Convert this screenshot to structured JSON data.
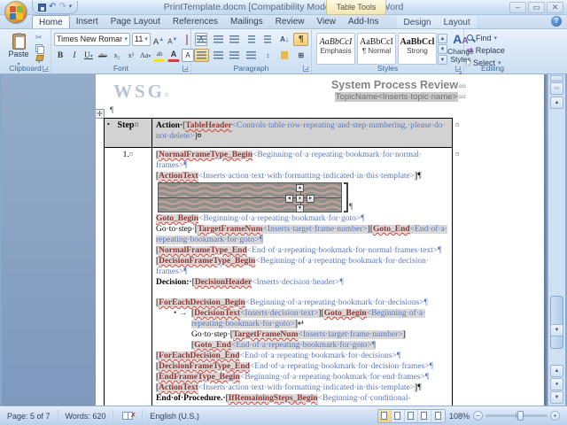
{
  "window": {
    "title": "PrintTemplate.docm [Compatibility Mode] - Microsoft Word",
    "context_group": "Table Tools",
    "minimize": "–",
    "restore": "▭",
    "close": "✕"
  },
  "tabs": {
    "main": [
      "Home",
      "Insert",
      "Page Layout",
      "References",
      "Mailings",
      "Review",
      "View",
      "Add-Ins"
    ],
    "active": "Home",
    "contextual": [
      "Design",
      "Layout"
    ]
  },
  "ribbon": {
    "clipboard": {
      "label": "Clipboard",
      "paste": "Paste"
    },
    "font": {
      "label": "Font",
      "family": "Times New Roman",
      "size": "11"
    },
    "paragraph": {
      "label": "Paragraph"
    },
    "styles": {
      "label": "Styles",
      "gallery": [
        {
          "sample": "AaBbCcI",
          "name": "Emphasis"
        },
        {
          "sample": "AaBbCcI",
          "name": "¶ Normal"
        },
        {
          "sample": "AaBbCcl",
          "name": "Strong"
        }
      ],
      "change_styles": "Change Styles"
    },
    "editing": {
      "label": "Editing",
      "find": "Find",
      "replace": "Replace",
      "select": "Select"
    }
  },
  "document": {
    "logo": "WSG",
    "logo_mark": "¤",
    "heading": "System Process Review",
    "heading_marks": "¤¤",
    "subheading": "TopicName<Inserts topic name>",
    "subheading_marks": "¤¤",
    "pilcrow": "¶",
    "table": {
      "row_end_mark": "¤",
      "header": {
        "bullet": "•",
        "step": "Step",
        "step_mark": "¤",
        "action_segments": [
          {
            "s": "bd",
            "t": "Action "
          },
          {
            "s": "gbh",
            "t": "["
          },
          {
            "s": "bk",
            "t": "TableHeader"
          },
          {
            "s": "blh",
            "t": "<Controls table row repeating and step numbering, please do not delete>"
          },
          {
            "s": "gbh",
            "t": "]"
          },
          {
            "s": "bd",
            "t": "¤"
          }
        ]
      },
      "row": {
        "step": "1.",
        "step_mark": "¤",
        "paragraphs": [
          {
            "segments": [
              {
                "s": "gb",
                "t": "["
              },
              {
                "s": "bk",
                "t": "NormalFrameType_Begin"
              },
              {
                "s": "blp",
                "t": "<Beginning of a repeating bookmark for normal frames>¶"
              }
            ]
          },
          {
            "segments": [
              {
                "s": "gb",
                "t": "["
              },
              {
                "s": "bk",
                "t": "ActionText"
              },
              {
                "s": "blp",
                "t": "<Inserts action text with formatting indicated in this template>"
              },
              {
                "s": "gb",
                "t": "]"
              },
              {
                "s": "nm",
                "t": "¶"
              }
            ]
          },
          {
            "type": "image",
            "alt": "selected placeholder frame with wavy texture and navigation arrows"
          },
          {
            "segments": [
              {
                "s": "bk",
                "t": "Goto_Begin"
              },
              {
                "s": "blp",
                "t": "<Beginning of a repeating bookmark for goto>¶"
              }
            ]
          },
          {
            "segments": [
              {
                "s": "nm",
                "t": "Go to step "
              },
              {
                "s": "gb",
                "t": "["
              },
              {
                "s": "bk",
                "t": "TargetFrameNum"
              },
              {
                "s": "bl",
                "t": "<Inserts target frame number>"
              },
              {
                "s": "gb",
                "t": "]["
              },
              {
                "s": "bk",
                "t": "Goto_End"
              },
              {
                "s": "bl",
                "t": "<End of a repeating bookmark for goto>¶"
              }
            ]
          },
          {
            "segments": [
              {
                "s": "gb",
                "t": "["
              },
              {
                "s": "bk",
                "t": "NormalFrameType_End"
              },
              {
                "s": "blp",
                "t": "<End of a repeating bookmark for normal frames text>¶"
              }
            ]
          },
          {
            "segments": [
              {
                "s": "gb",
                "t": "["
              },
              {
                "s": "bk",
                "t": "DecisionFrameType_Begin"
              },
              {
                "s": "blp",
                "t": "<Beginning of a repeating bookmark for decision frames>¶"
              }
            ]
          },
          {
            "segments": [
              {
                "s": "bd",
                "t": "Decision: "
              },
              {
                "s": "gb",
                "t": "["
              },
              {
                "s": "bk",
                "t": "DecisionHeader"
              },
              {
                "s": "blp",
                "t": "<Inserts decision header>¶"
              }
            ]
          },
          {
            "type": "gap"
          },
          {
            "segments": [
              {
                "s": "gb",
                "t": "["
              },
              {
                "s": "bk",
                "t": "ForEachDecision_Begin"
              },
              {
                "s": "blp",
                "t": "<Beginning of a repeating bookmark for decisions>¶"
              }
            ]
          },
          {
            "indent": true,
            "bullet": "• →",
            "segments": [
              {
                "s": "gb",
                "t": "["
              },
              {
                "s": "bk",
                "t": "DecisionText"
              },
              {
                "s": "bl",
                "t": "<Inserts decision text>"
              },
              {
                "s": "gb",
                "t": "]["
              },
              {
                "s": "bk",
                "t": "Goto_Begin"
              },
              {
                "s": "bl",
                "t": "<Beginning of a repeating bookmark for goto>"
              },
              {
                "s": "gb",
                "t": "]"
              },
              {
                "s": "nm",
                "t": "↵"
              }
            ]
          },
          {
            "indent": true,
            "segments": [
              {
                "s": "nm",
                "t": "Go to step "
              },
              {
                "s": "gb",
                "t": "["
              },
              {
                "s": "bk",
                "t": "TargetFrameNum"
              },
              {
                "s": "bl",
                "t": "<Inserts target frame number>"
              },
              {
                "s": "gb",
                "t": "]["
              },
              {
                "s": "bk",
                "t": "Goto_End"
              },
              {
                "s": "bl",
                "t": "<End of a repeating bookmark for goto>¶"
              }
            ]
          },
          {
            "segments": [
              {
                "s": "gb",
                "t": "["
              },
              {
                "s": "bk",
                "t": "ForEachDecision_End"
              },
              {
                "s": "blp",
                "t": "<End of a repeating bookmark for decisions>¶"
              }
            ]
          },
          {
            "segments": [
              {
                "s": "gb",
                "t": "["
              },
              {
                "s": "bk",
                "t": "DecisionFrameType_End"
              },
              {
                "s": "blp",
                "t": "<End of a repeating bookmark for decision frames>¶"
              }
            ]
          },
          {
            "segments": [
              {
                "s": "gb",
                "t": "["
              },
              {
                "s": "bk",
                "t": "EndFrameType_Begin"
              },
              {
                "s": "blp",
                "t": "<Beginning of a repeating bookmark for end frames>¶"
              }
            ]
          },
          {
            "segments": [
              {
                "s": "gb",
                "t": "["
              },
              {
                "s": "bk",
                "t": "ActionText"
              },
              {
                "s": "blp",
                "t": "<Inserts action text with formatting indicated in this template>"
              },
              {
                "s": "gb",
                "t": "]"
              },
              {
                "s": "nm",
                "t": "¶"
              }
            ]
          },
          {
            "segments": [
              {
                "s": "bd",
                "t": "End of Procedure. "
              },
              {
                "s": "gb",
                "t": "["
              },
              {
                "s": "bk",
                "t": "IfRemainingSteps_Begin"
              },
              {
                "s": "blp",
                "t": "<Beginning of conditional-"
              }
            ]
          }
        ]
      }
    }
  },
  "status_bar": {
    "page": "Page: 5 of 7",
    "words": "Words: 620",
    "language": "English (U.S.)",
    "zoom": "108%"
  },
  "colors": {
    "bookmark_red": "#943634",
    "template_blue": "#5a77c0",
    "field_shading": "#d8d8d8",
    "table_header_gray": "#d2d2d2",
    "show_hide_active": "#fbce72"
  }
}
